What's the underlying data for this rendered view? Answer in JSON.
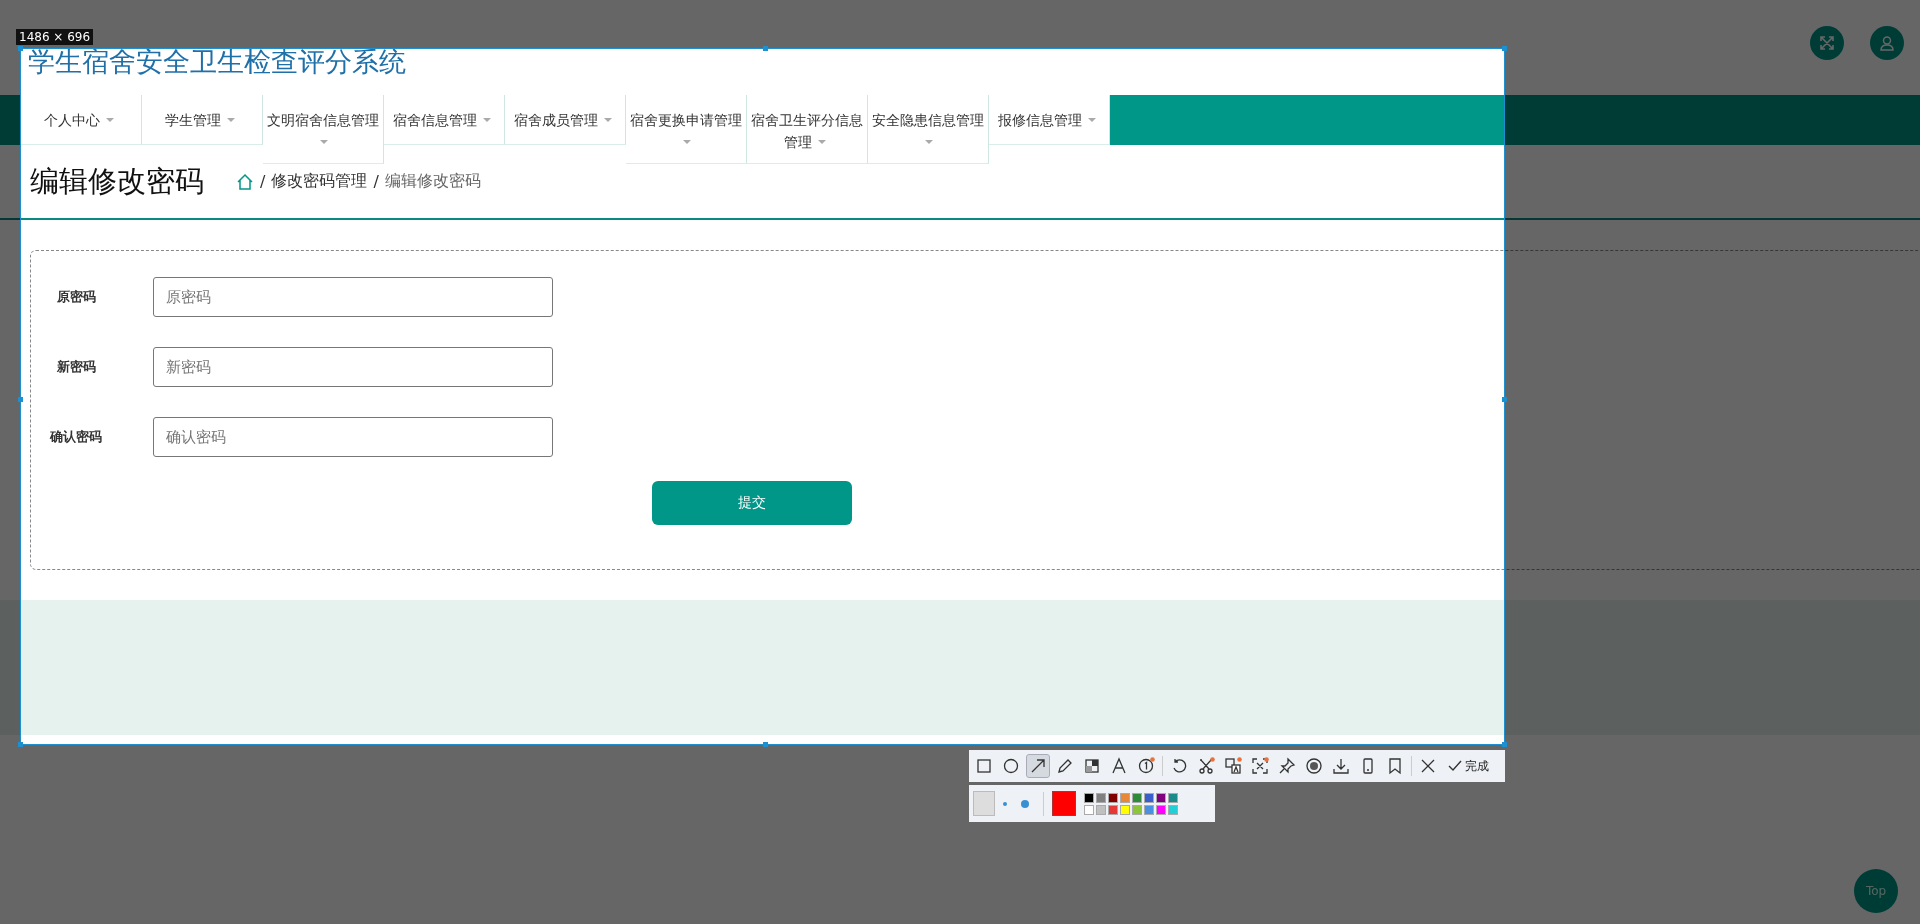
{
  "app": {
    "title": "学生宿舍安全卫生检查评分系统"
  },
  "nav": [
    {
      "label": "个人中心"
    },
    {
      "label": "学生管理"
    },
    {
      "label": "文明宿舍信息管理"
    },
    {
      "label": "宿舍信息管理"
    },
    {
      "label": "宿舍成员管理"
    },
    {
      "label": "宿舍更换申请管理"
    },
    {
      "label": "宿舍卫生评分信息管理"
    },
    {
      "label": "安全隐患信息管理"
    },
    {
      "label": "报修信息管理"
    }
  ],
  "page_title": "编辑修改密码",
  "breadcrumb": {
    "separator": "/",
    "items": [
      "修改密码管理",
      "编辑修改密码"
    ]
  },
  "form": {
    "fields": [
      {
        "label": "原密码",
        "placeholder": "原密码"
      },
      {
        "label": "新密码",
        "placeholder": "新密码"
      },
      {
        "label": "确认密码",
        "placeholder": "确认密码"
      }
    ],
    "submit": "提交"
  },
  "back_to_top": "Top",
  "capture": {
    "size_label": "1486 × 696",
    "tools": [
      {
        "kind": "rect",
        "selected": false,
        "badge": false
      },
      {
        "kind": "ellipse",
        "selected": false,
        "badge": false
      },
      {
        "kind": "arrow",
        "selected": true,
        "badge": false
      },
      {
        "kind": "pen",
        "selected": false,
        "badge": false
      },
      {
        "kind": "mosaic",
        "selected": false,
        "badge": false
      },
      {
        "kind": "text",
        "selected": false,
        "badge": false
      },
      {
        "kind": "number",
        "selected": false,
        "badge": true
      },
      {
        "kind": "sep"
      },
      {
        "kind": "undo",
        "selected": false,
        "badge": false
      },
      {
        "kind": "scissors",
        "selected": false,
        "badge": true
      },
      {
        "kind": "translate",
        "selected": false,
        "badge": true
      },
      {
        "kind": "ocr",
        "selected": false,
        "badge": true
      },
      {
        "kind": "pin",
        "selected": false,
        "badge": false
      },
      {
        "kind": "record",
        "selected": false,
        "badge": false
      },
      {
        "kind": "download",
        "selected": false,
        "badge": false
      },
      {
        "kind": "phone",
        "selected": false,
        "badge": false
      },
      {
        "kind": "bookmark",
        "selected": false,
        "badge": false
      },
      {
        "kind": "sep"
      },
      {
        "kind": "close",
        "selected": false,
        "badge": false
      }
    ],
    "done_label": "完成",
    "swatches": [
      {
        "color": "#000000"
      },
      {
        "color": "#808080"
      },
      {
        "color": "#800000"
      },
      {
        "color": "#e8873a"
      },
      {
        "color": "#2e8b3a"
      },
      {
        "color": "#3a5fcd"
      },
      {
        "color": "#800080"
      },
      {
        "color": "#1a8b8b"
      },
      {
        "color": "#ffffff"
      },
      {
        "color": "#c0c0c0"
      },
      {
        "color": "#e53935"
      },
      {
        "color": "#ffff00"
      },
      {
        "color": "#8cc43a"
      },
      {
        "color": "#4a90e2"
      },
      {
        "color": "#ff00ff"
      },
      {
        "color": "#22cfd6"
      }
    ]
  }
}
